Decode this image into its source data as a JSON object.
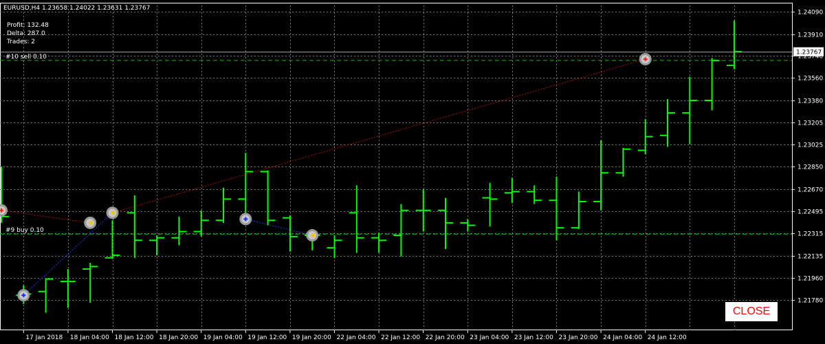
{
  "header": {
    "symbol_line": "EURUSD,H4  1.23658 1.24022 1.23631 1.23767",
    "stats": [
      "Profit: 132.48",
      "Delta: 287.0",
      "Trades: 2"
    ]
  },
  "close_button": {
    "label": "CLOSE",
    "text_color": "#ff0000",
    "bg_color": "#ffffff"
  },
  "colors": {
    "background": "#000000",
    "grid": "#7a7a7a",
    "candle": "#00ff00",
    "sell_line": "#b01010",
    "buy_line": "#1a3cff",
    "order_level": "#00c800"
  },
  "chart_data": {
    "type": "ohlc",
    "symbol": "EURUSD",
    "timeframe": "H4",
    "ylim": [
      1.2154,
      1.2414
    ],
    "grid": true,
    "y_ticks": [
      "1.24090",
      "1.23910",
      "1.23740",
      "1.23560",
      "1.23380",
      "1.23205",
      "1.23025",
      "1.22850",
      "1.22670",
      "1.22495",
      "1.22315",
      "1.22135",
      "1.21960",
      "1.21780"
    ],
    "x_ticks": [
      "17 Jan 2018",
      "18 Jan 04:00",
      "18 Jan 12:00",
      "18 Jan 20:00",
      "19 Jan 04:00",
      "19 Jan 12:00",
      "19 Jan 20:00",
      "22 Jan 04:00",
      "22 Jan 12:00",
      "22 Jan 20:00",
      "23 Jan 04:00",
      "23 Jan 12:00",
      "23 Jan 20:00",
      "24 Jan 04:00",
      "24 Jan 12:00"
    ],
    "x_tick_bar_index": [
      1,
      3,
      5,
      7,
      9,
      11,
      13,
      15,
      17,
      19,
      21,
      23,
      25,
      27,
      29
    ],
    "current_price": "1.23767",
    "bars": [
      {
        "o": 1.225,
        "h": 1.2285,
        "l": 1.224,
        "c": 1.2245
      },
      {
        "o": 1.2182,
        "h": 1.219,
        "l": 1.2175,
        "c": 1.2183
      },
      {
        "o": 1.2185,
        "h": 1.2195,
        "l": 1.2168,
        "c": 1.2195
      },
      {
        "o": 1.2193,
        "h": 1.2203,
        "l": 1.2172,
        "c": 1.2193
      },
      {
        "o": 1.2203,
        "h": 1.2208,
        "l": 1.2176,
        "c": 1.2205
      },
      {
        "o": 1.2212,
        "h": 1.2242,
        "l": 1.2211,
        "c": 1.2214
      },
      {
        "o": 1.2248,
        "h": 1.2262,
        "l": 1.2212,
        "c": 1.2226
      },
      {
        "o": 1.2226,
        "h": 1.223,
        "l": 1.2214,
        "c": 1.2228
      },
      {
        "o": 1.2228,
        "h": 1.2245,
        "l": 1.2222,
        "c": 1.2233
      },
      {
        "o": 1.2233,
        "h": 1.225,
        "l": 1.2229,
        "c": 1.2242
      },
      {
        "o": 1.2242,
        "h": 1.2268,
        "l": 1.224,
        "c": 1.2259
      },
      {
        "o": 1.2259,
        "h": 1.2296,
        "l": 1.2248,
        "c": 1.2281
      },
      {
        "o": 1.2281,
        "h": 1.2282,
        "l": 1.2238,
        "c": 1.2242
      },
      {
        "o": 1.2244,
        "h": 1.2246,
        "l": 1.2217,
        "c": 1.2229
      },
      {
        "o": 1.223,
        "h": 1.2232,
        "l": 1.2218,
        "c": 1.223
      },
      {
        "o": 1.222,
        "h": 1.223,
        "l": 1.2212,
        "c": 1.2226
      },
      {
        "o": 1.2248,
        "h": 1.227,
        "l": 1.2216,
        "c": 1.2228
      },
      {
        "o": 1.2228,
        "h": 1.2232,
        "l": 1.2216,
        "c": 1.2226
      },
      {
        "o": 1.223,
        "h": 1.2255,
        "l": 1.2213,
        "c": 1.225
      },
      {
        "o": 1.225,
        "h": 1.2267,
        "l": 1.2233,
        "c": 1.225
      },
      {
        "o": 1.225,
        "h": 1.226,
        "l": 1.2219,
        "c": 1.224
      },
      {
        "o": 1.224,
        "h": 1.2243,
        "l": 1.2233,
        "c": 1.2238
      },
      {
        "o": 1.226,
        "h": 1.2272,
        "l": 1.2237,
        "c": 1.2259
      },
      {
        "o": 1.2264,
        "h": 1.2276,
        "l": 1.2256,
        "c": 1.2265
      },
      {
        "o": 1.2265,
        "h": 1.227,
        "l": 1.2255,
        "c": 1.2258
      },
      {
        "o": 1.2258,
        "h": 1.2277,
        "l": 1.2226,
        "c": 1.2236
      },
      {
        "o": 1.2236,
        "h": 1.2265,
        "l": 1.2235,
        "c": 1.2257
      },
      {
        "o": 1.2257,
        "h": 1.2306,
        "l": 1.225,
        "c": 1.228
      },
      {
        "o": 1.228,
        "h": 1.23,
        "l": 1.2277,
        "c": 1.2299
      },
      {
        "o": 1.2298,
        "h": 1.2323,
        "l": 1.2295,
        "c": 1.2309
      },
      {
        "o": 1.231,
        "h": 1.2339,
        "l": 1.2301,
        "c": 1.2328
      },
      {
        "o": 1.2328,
        "h": 1.2357,
        "l": 1.2303,
        "c": 1.2338
      },
      {
        "o": 1.2338,
        "h": 1.2372,
        "l": 1.233,
        "c": 1.237
      },
      {
        "o": 1.2366,
        "h": 1.2402,
        "l": 1.2363,
        "c": 1.2377
      }
    ],
    "orders": [
      {
        "label": "#10 sell 0.10",
        "side": "sell",
        "open_bar": 0,
        "open_price": 1.225,
        "close_bar": 4,
        "close_price": 1.224,
        "level": 1.237
      },
      {
        "label": "#9 buy 0.10",
        "side": "buy",
        "open_bar": 1,
        "open_price": 1.2182,
        "close_bar": 5,
        "close_price": 1.2248,
        "level": 1.2231
      }
    ],
    "markers": [
      {
        "bar": 0,
        "price": 1.225,
        "kind": "sell"
      },
      {
        "bar": 1,
        "price": 1.2182,
        "kind": "buy"
      },
      {
        "bar": 4,
        "price": 1.224,
        "kind": "buy-close"
      },
      {
        "bar": 5,
        "price": 1.2248,
        "kind": "sell-close"
      },
      {
        "bar": 11,
        "price": 1.2243,
        "kind": "buy"
      },
      {
        "bar": 14,
        "price": 1.223,
        "kind": "buy-close"
      },
      {
        "bar": 29,
        "price": 1.2371,
        "kind": "sell"
      }
    ]
  }
}
